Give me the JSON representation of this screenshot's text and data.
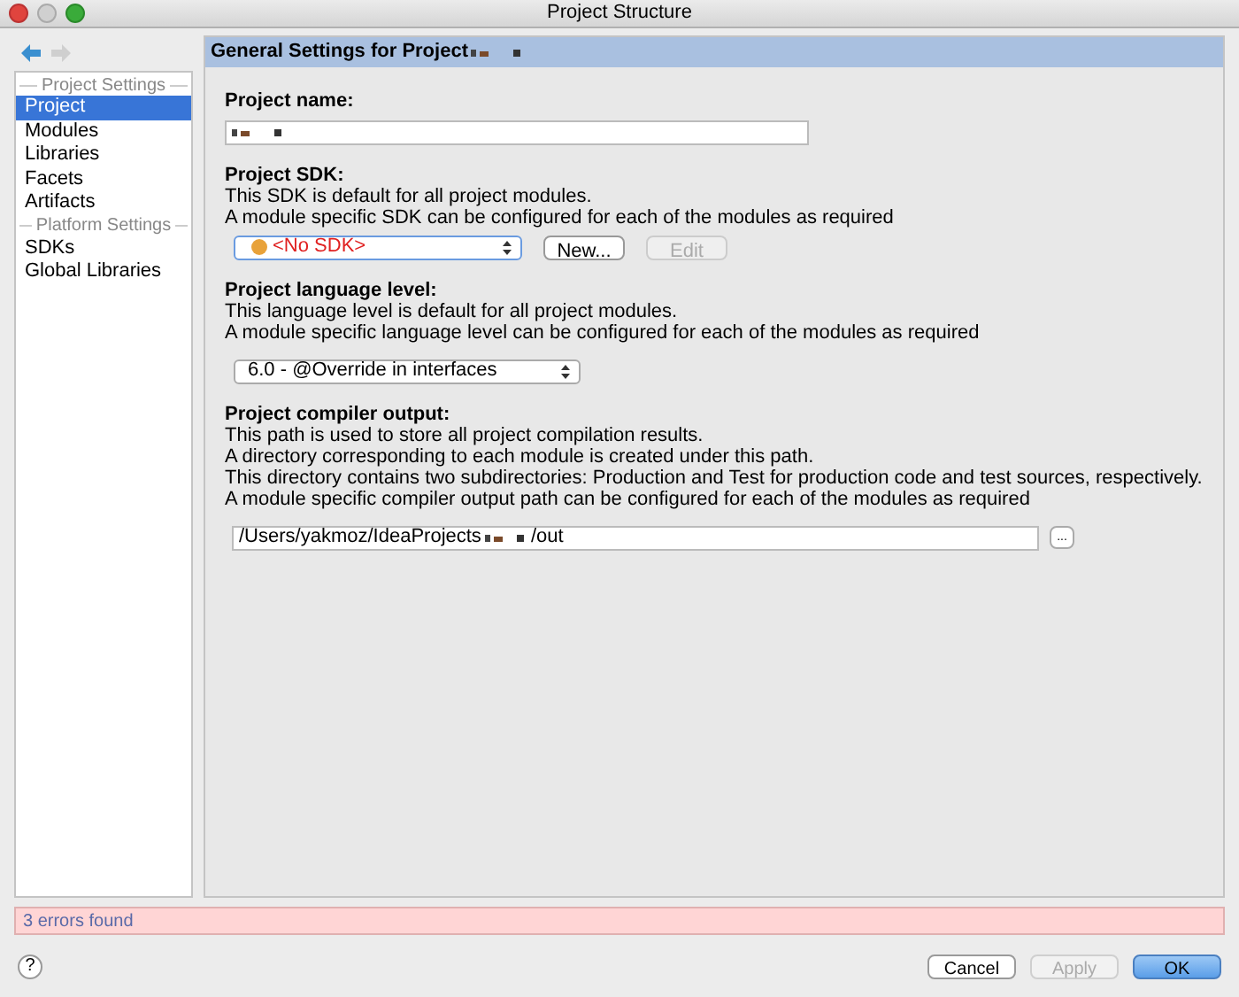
{
  "window": {
    "title": "Project Structure"
  },
  "sidebar": {
    "groups": [
      {
        "label": "Project Settings",
        "items": [
          {
            "label": "Project",
            "selected": true
          },
          {
            "label": "Modules",
            "selected": false
          },
          {
            "label": "Libraries",
            "selected": false
          },
          {
            "label": "Facets",
            "selected": false
          },
          {
            "label": "Artifacts",
            "selected": false
          }
        ]
      },
      {
        "label": "Platform Settings",
        "items": [
          {
            "label": "SDKs",
            "selected": false
          },
          {
            "label": "Global Libraries",
            "selected": false
          }
        ]
      }
    ]
  },
  "panel": {
    "header": "General Settings for Project",
    "project_name": {
      "label": "Project name:"
    },
    "sdk": {
      "label": "Project SDK:",
      "lines": [
        "This SDK is default for all project modules.",
        "A module specific SDK can be configured for each of the modules as required"
      ],
      "value": "<No SDK>",
      "buttons": [
        {
          "label": "New...",
          "disabled": false
        },
        {
          "label": "Edit",
          "disabled": true
        }
      ]
    },
    "language_level": {
      "label": "Project language level:",
      "lines": [
        "This language level is default for all project modules.",
        "A module specific language level can be configured for each of the modules as required"
      ],
      "value": "6.0 - @Override in interfaces"
    },
    "compiler_output": {
      "label": "Project compiler output:",
      "lines": [
        "This path is used to store all project compilation results.",
        "A directory corresponding to each module is created under this path.",
        "This directory contains two subdirectories: Production and Test for production code and test sources, respectively.",
        "A module specific compiler output path can be configured for each of the modules as required"
      ],
      "path_start": "/Users/yakmoz/IdeaProjects",
      "path_end": "/out",
      "browse": "..."
    }
  },
  "status": "3 errors found",
  "help": "?",
  "buttons": [
    {
      "label": "Cancel",
      "kind": "normal",
      "disabled": false
    },
    {
      "label": "Apply",
      "kind": "normal",
      "disabled": true
    },
    {
      "label": "OK",
      "kind": "default"
    }
  ]
}
